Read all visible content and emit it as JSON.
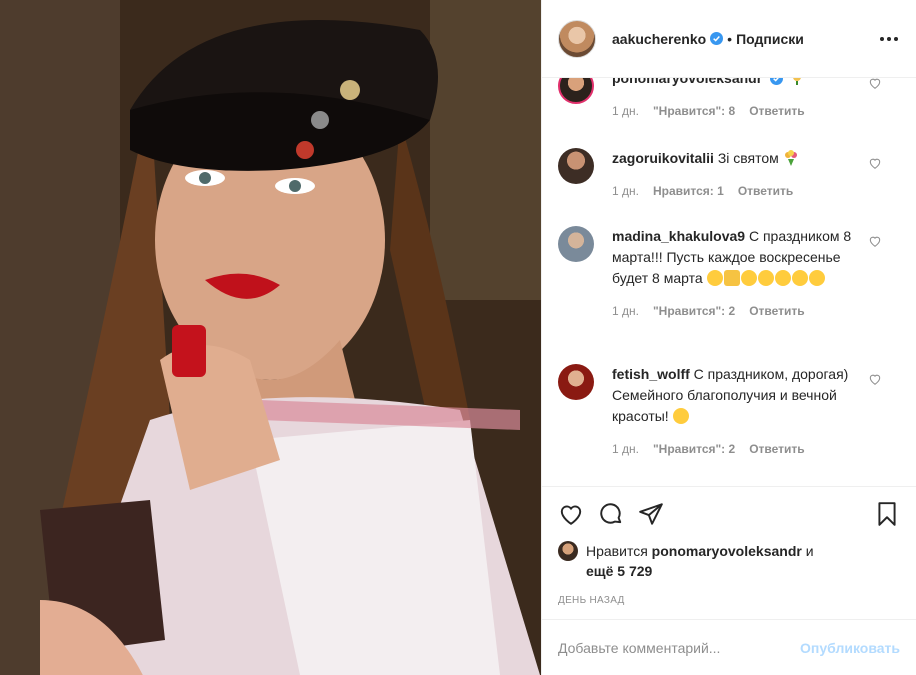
{
  "header": {
    "username": "aakucherenko",
    "separator": "•",
    "follow_label": "Подписки"
  },
  "comments": [
    {
      "user": "ponomaryovoleksandr",
      "text": "",
      "time": "1 дн.",
      "likes": "\"Нравится\": 8",
      "reply": "Ответить"
    },
    {
      "user": "zagoruikovitalii",
      "text": "Зі святом",
      "time": "1 дн.",
      "likes": "Нравится: 1",
      "reply": "Ответить"
    },
    {
      "user": "madina_khakulova9",
      "text": "С праздником 8 марта!!! Пусть каждое воскресенье будет 8 марта",
      "time": "1 дн.",
      "likes": "\"Нравится\": 2",
      "reply": "Ответить"
    },
    {
      "user": "fetish_wolff",
      "text": "С праздником, дорогая) Семейного благополучия и вечной красоты!",
      "time": "1 дн.",
      "likes": "\"Нравится\": 2",
      "reply": "Ответить"
    }
  ],
  "likes": {
    "prefix": "Нравится",
    "user": "ponomaryovoleksandr",
    "and": "и",
    "more": "ещё 5 729"
  },
  "timestamp": "ДЕНЬ НАЗАД",
  "add_comment": {
    "placeholder": "Добавьте комментарий...",
    "publish_label": "Опубликовать"
  },
  "icons": [
    "verified-icon",
    "more-icon",
    "heart-icon",
    "comment-icon",
    "share-icon",
    "bookmark-icon"
  ],
  "colors": {
    "accent": "#0095f6",
    "publish_disabled": "#b3dbff",
    "verified": "#3897f0"
  }
}
